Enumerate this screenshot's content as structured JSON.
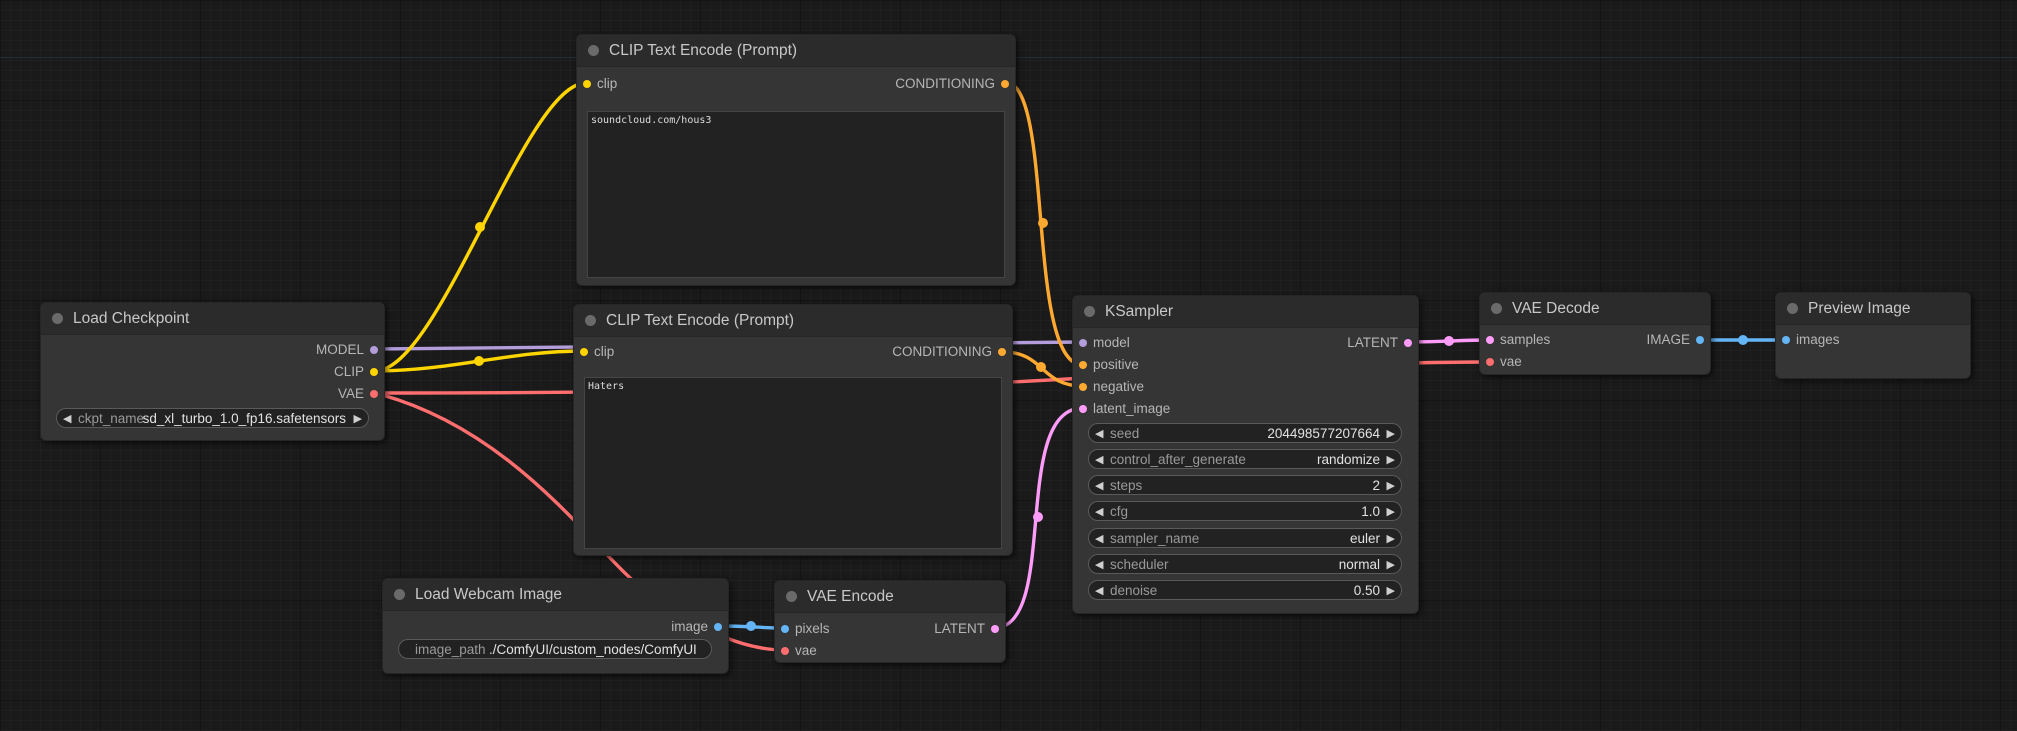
{
  "colors": {
    "model": "#b39ddb",
    "clip": "#ffd500",
    "vae": "#ff6e6e",
    "conditioning": "#ffa931",
    "latent": "#ff9cf9",
    "image": "#64b5f6"
  },
  "nodes": {
    "clip_text_encode_1": {
      "title": "CLIP Text Encode (Prompt)",
      "input_clip": "clip",
      "output_conditioning": "CONDITIONING",
      "text": "soundcloud.com/hous3"
    },
    "clip_text_encode_2": {
      "title": "CLIP Text Encode (Prompt)",
      "input_clip": "clip",
      "output_conditioning": "CONDITIONING",
      "text": "Haters"
    },
    "load_checkpoint": {
      "title": "Load Checkpoint",
      "output_model": "MODEL",
      "output_clip": "CLIP",
      "output_vae": "VAE",
      "ckpt_label": "ckpt_name",
      "ckpt_value": "sd_xl_turbo_1.0_fp16.safetensors"
    },
    "ksampler": {
      "title": "KSampler",
      "input_model": "model",
      "input_positive": "positive",
      "input_negative": "negative",
      "input_latent_image": "latent_image",
      "output_latent": "LATENT",
      "widgets": [
        {
          "label": "seed",
          "value": "204498577207664"
        },
        {
          "label": "control_after_generate",
          "value": "randomize"
        },
        {
          "label": "steps",
          "value": "2"
        },
        {
          "label": "cfg",
          "value": "1.0"
        },
        {
          "label": "sampler_name",
          "value": "euler"
        },
        {
          "label": "scheduler",
          "value": "normal"
        },
        {
          "label": "denoise",
          "value": "0.50"
        }
      ]
    },
    "vae_decode": {
      "title": "VAE Decode",
      "input_samples": "samples",
      "input_vae": "vae",
      "output_image": "IMAGE"
    },
    "preview_image": {
      "title": "Preview Image",
      "input_images": "images"
    },
    "load_webcam_image": {
      "title": "Load Webcam Image",
      "output_image": "image",
      "image_path_label": "image_path",
      "image_path_value": "./ComfyUI/custom_nodes/ComfyUI"
    },
    "vae_encode": {
      "title": "VAE Encode",
      "input_pixels": "pixels",
      "input_vae": "vae",
      "output_latent": "LATENT"
    }
  }
}
